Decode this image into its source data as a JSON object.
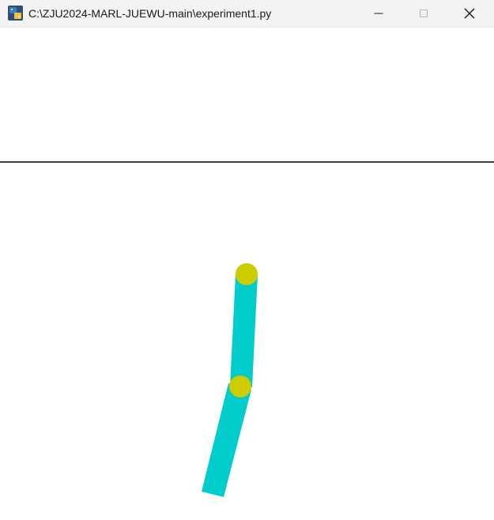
{
  "window": {
    "title": "C:\\ZJU2024-MARL-JUEWU-main\\experiment1.py",
    "app_icon": "python-icon",
    "controls": [
      "minimize-icon",
      "maximize-icon",
      "close-icon"
    ]
  },
  "scene": {
    "background": "#ffffff",
    "ground_line_color": "#000000",
    "pole_color": "#00cccc",
    "joint_color": "#cccc00"
  }
}
